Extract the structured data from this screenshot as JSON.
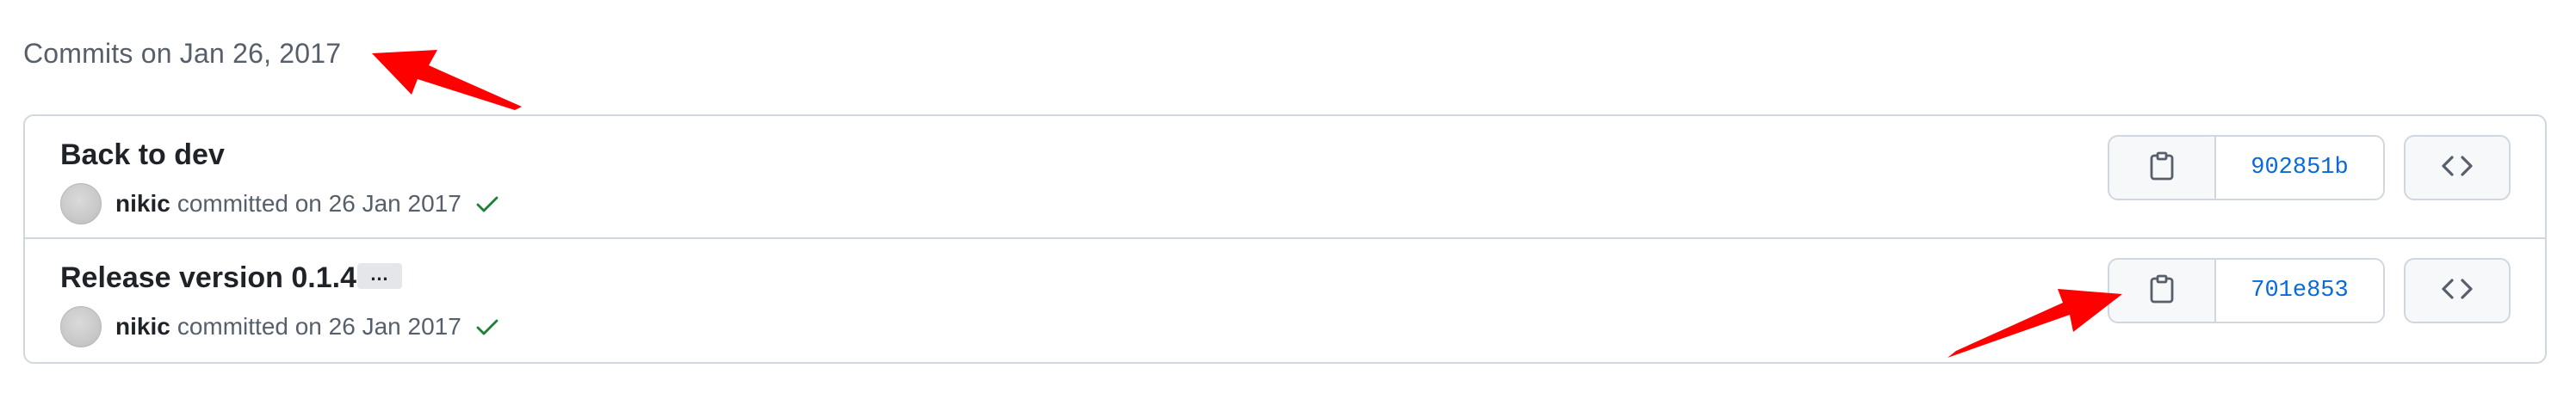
{
  "heading": "Commits on Jan 26, 2017",
  "commits": [
    {
      "title": "Back to dev",
      "author": "nikic",
      "committed_text": "committed on 26 Jan 2017",
      "sha": "902851b",
      "has_ellipsis": false
    },
    {
      "title": "Release version 0.1.4",
      "ellipsis_label": "…",
      "author": "nikic",
      "committed_text": "committed on 26 Jan 2017",
      "sha": "701e853",
      "has_ellipsis": true
    }
  ],
  "icons": {
    "copy": "clipboard-icon",
    "browse": "code-icon",
    "status": "check-icon"
  },
  "colors": {
    "link": "#0969da",
    "success": "#1a7f37",
    "annotation_arrow": "#ff0000",
    "border": "#d0d7de"
  }
}
